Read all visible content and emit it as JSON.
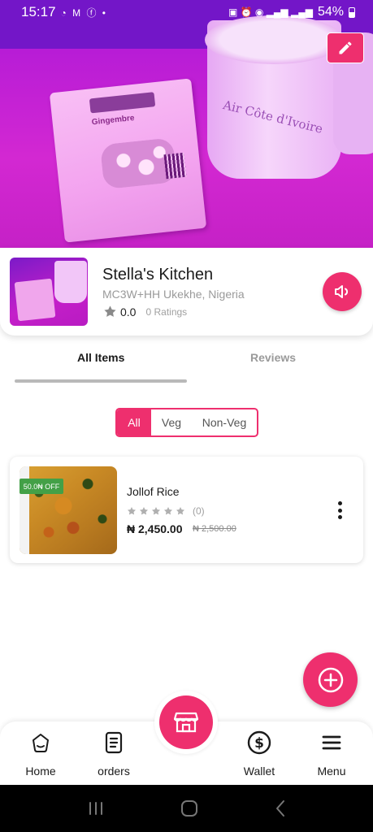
{
  "status_bar": {
    "time": "15:17",
    "app_icons": "◔ M ⓕ •",
    "battery": "54%"
  },
  "cover": {
    "cup_logo": "Air Côte d'Ivoire",
    "pack_title": "Gingembre"
  },
  "store": {
    "name": "Stella's Kitchen",
    "address": "MC3W+HH Ukekhe, Nigeria",
    "rating": "0.0",
    "ratings_count": "0 Ratings"
  },
  "tabs": [
    {
      "label": "All Items",
      "active": true
    },
    {
      "label": "Reviews",
      "active": false
    }
  ],
  "filters": [
    {
      "label": "All",
      "selected": true
    },
    {
      "label": "Veg",
      "selected": false
    },
    {
      "label": "Non-Veg",
      "selected": false
    }
  ],
  "items": [
    {
      "name": "Jollof Rice",
      "discount_badge": "50.0₦ OFF",
      "review_count": "(0)",
      "price": "₦ 2,450.00",
      "original_price": "₦ 2,500.00",
      "stars_filled": 0
    }
  ],
  "bottom_nav": {
    "home": "Home",
    "orders": "orders",
    "wallet": "Wallet",
    "menu": "Menu"
  },
  "colors": {
    "accent": "#ee2f6e",
    "discount_green": "#43a047"
  }
}
